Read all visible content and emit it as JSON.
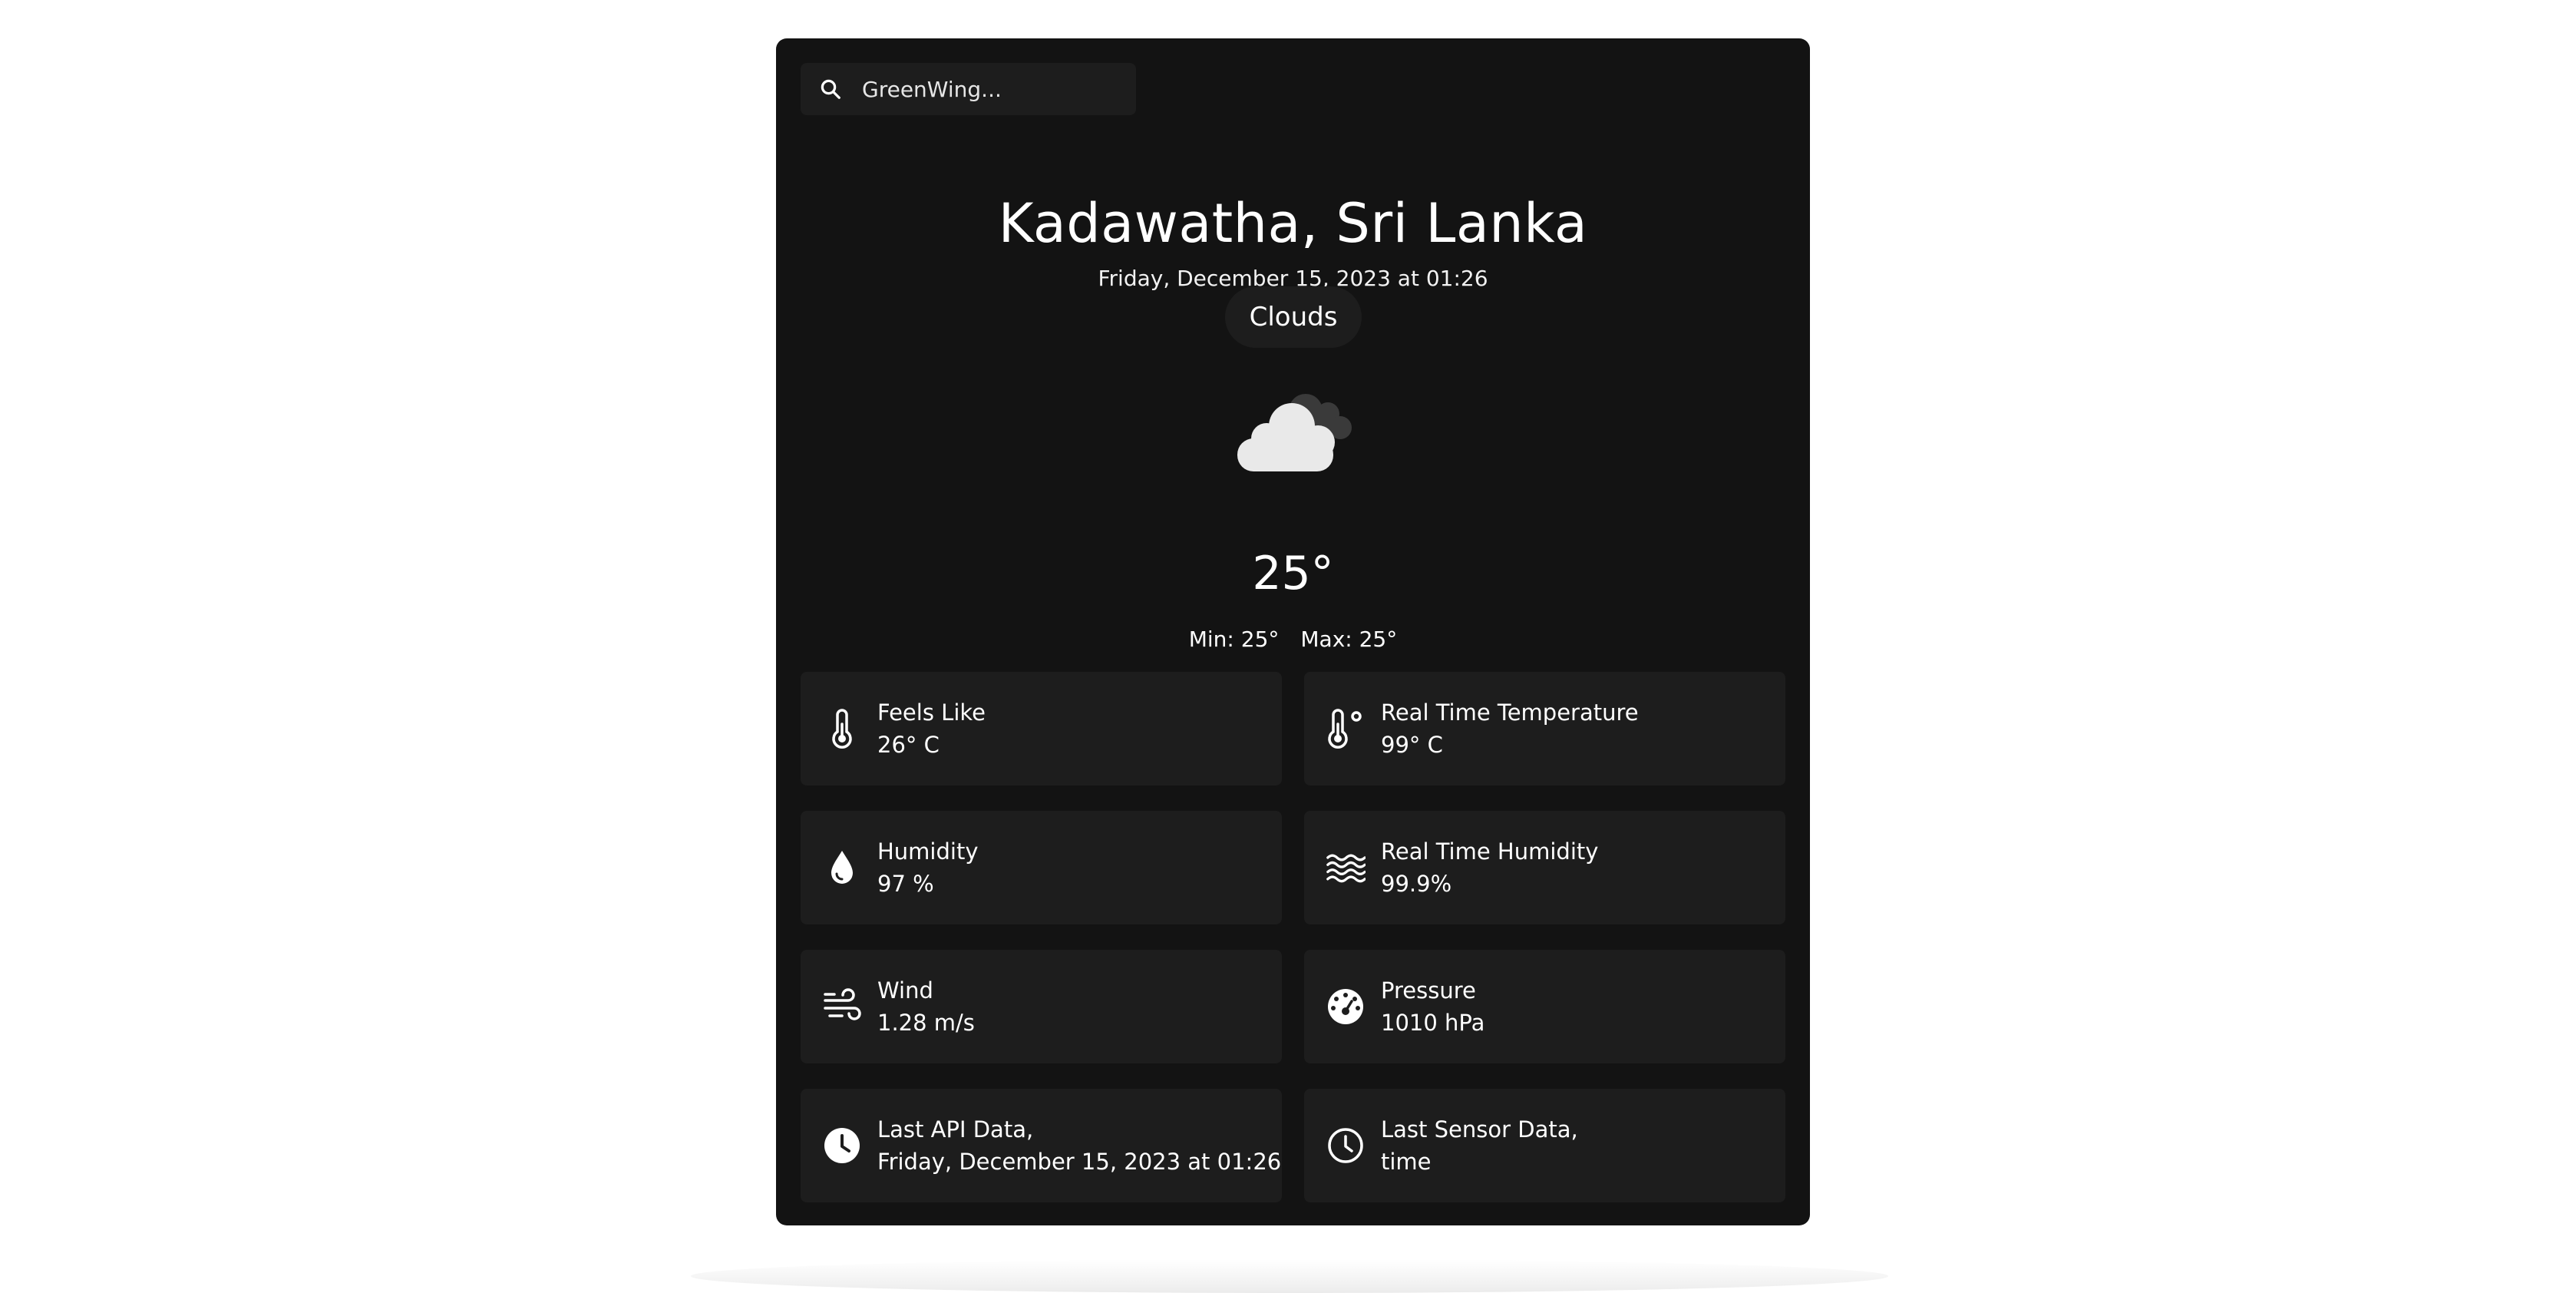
{
  "search": {
    "placeholder": "GreenWing...",
    "icon": "search-icon"
  },
  "location": {
    "title": "Kadawatha, Sri Lanka",
    "datetime": "Friday, December 15, 2023 at 01:26"
  },
  "weather": {
    "condition": "Clouds",
    "icon": "cloud-icon",
    "temperature": "25°",
    "min": "Min: 25°",
    "max": "Max: 25°"
  },
  "tiles": [
    {
      "label": "Feels Like",
      "value": "26° C",
      "icon": "thermometer-icon"
    },
    {
      "label": "Real Time Temperature",
      "value": "99° C",
      "icon": "thermometer-degree-icon"
    },
    {
      "label": "Humidity",
      "value": "97 %",
      "icon": "droplet-icon"
    },
    {
      "label": "Real Time Humidity",
      "value": "99.9%",
      "icon": "water-waves-icon"
    },
    {
      "label": "Wind",
      "value": "1.28 m/s",
      "icon": "wind-icon"
    },
    {
      "label": "Pressure",
      "value": "1010 hPa",
      "icon": "gauge-icon"
    },
    {
      "label": "Last API Data,",
      "value": "Friday, December 15, 2023 at 01:26",
      "icon": "clock-solid-icon"
    },
    {
      "label": "Last Sensor Data,",
      "value": "time",
      "icon": "clock-outline-icon"
    }
  ],
  "colors": {
    "page_background": "#ffffff",
    "card_background": "#131313",
    "tile_background": "#1d1d1d",
    "text": "#ffffff"
  }
}
